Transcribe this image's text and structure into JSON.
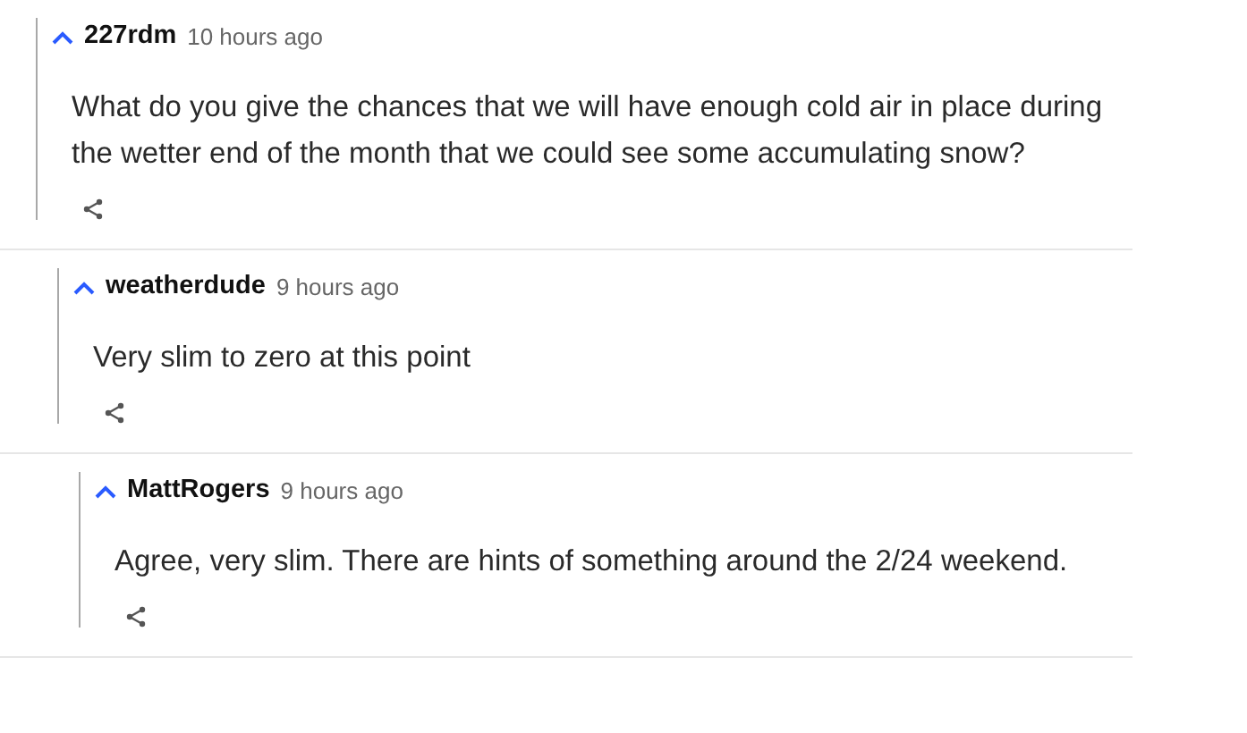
{
  "comments": [
    {
      "author": "227rdm",
      "time": "10 hours ago",
      "text": "What do you give the chances that we will have enough cold air in place during the wetter end of the month that we could see some accumulating snow?",
      "children": [
        {
          "author": "weatherdude",
          "time": "9 hours ago",
          "text": "Very slim to zero at this point",
          "children": [
            {
              "author": "MattRogers",
              "time": "9 hours ago",
              "text": "Agree, very slim. There are hints of something around the 2/24 weekend."
            }
          ]
        }
      ]
    }
  ]
}
